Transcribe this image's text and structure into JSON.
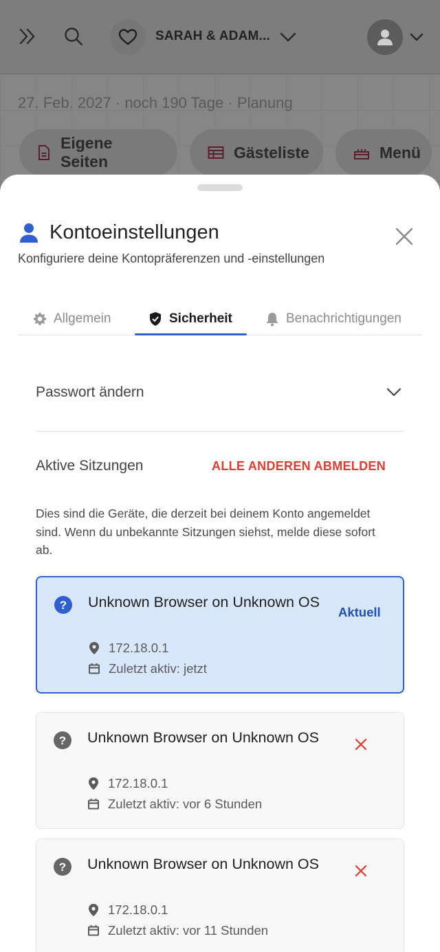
{
  "topbar": {
    "couple_name": "SARAH & ADAM...",
    "expand_icon": "chevrons-right-icon",
    "search_icon": "search-icon",
    "heart_icon": "heart-icon",
    "avatar_icon": "user-avatar-icon"
  },
  "hero": {
    "date_line": "27. Feb. 2027 · noch 190 Tage · Planung",
    "pills": [
      {
        "label": "Eigene Seiten",
        "icon": "document-icon"
      },
      {
        "label": "Gästeliste",
        "icon": "table-icon"
      },
      {
        "label": "Menü",
        "icon": "cake-icon"
      }
    ]
  },
  "sheet": {
    "title": "Kontoeinstellungen",
    "subtitle": "Konfiguriere deine Kontopräferenzen und -einstellungen",
    "tabs": [
      {
        "label": "Allgemein",
        "icon": "gear-icon"
      },
      {
        "label": "Sicherheit",
        "icon": "shield-icon",
        "active": true
      },
      {
        "label": "Benachrichtigungen",
        "icon": "bell-icon"
      }
    ],
    "password_label": "Passwort ändern",
    "sessions": {
      "title": "Aktive Sitzungen",
      "logout_all": "ALLE ANDEREN ABMELDEN",
      "description": "Dies sind die Geräte, die derzeit bei deinem Konto angemeldet sind. Wenn du unbekannte Sitzungen siehst, melde diese sofort ab.",
      "items": [
        {
          "title": "Unknown Browser on Unknown OS",
          "ip": "172.18.0.1",
          "last_active": "Zuletzt aktiv: jetzt",
          "badge": "Aktuell",
          "current": true
        },
        {
          "title": "Unknown Browser on Unknown OS",
          "ip": "172.18.0.1",
          "last_active": "Zuletzt aktiv: vor 6 Stunden",
          "current": false
        },
        {
          "title": "Unknown Browser on Unknown OS",
          "ip": "172.18.0.1",
          "last_active": "Zuletzt aktiv: vor 11 Stunden",
          "current": false
        }
      ]
    }
  },
  "colors": {
    "accent": "#2f5fd0",
    "danger": "#e53a2f",
    "current_bg": "#d9e7fc"
  }
}
